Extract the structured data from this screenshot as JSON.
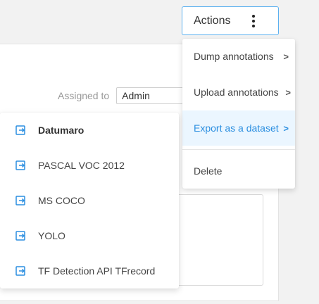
{
  "actions": {
    "label": "Actions",
    "icon": "more-vertical-icon"
  },
  "task": {
    "assigned_label": "Assigned to",
    "assigned_value": "Admin"
  },
  "menu": {
    "items": [
      {
        "label": "Dump annotations",
        "arrow": ">"
      },
      {
        "label": "Upload annotations",
        "arrow": ">"
      },
      {
        "label": "Export as a dataset",
        "arrow": ">",
        "active": true
      },
      {
        "label": "Delete"
      }
    ]
  },
  "export_formats": {
    "icon": "export-icon",
    "items": [
      {
        "label": "Datumaro"
      },
      {
        "label": "PASCAL VOC 2012"
      },
      {
        "label": "MS COCO"
      },
      {
        "label": "YOLO"
      },
      {
        "label": "TF Detection API TFrecord"
      }
    ]
  },
  "colors": {
    "accent": "#2a8ee0",
    "active_bg": "#ebf6ff",
    "button_border": "#5bb0f0"
  }
}
